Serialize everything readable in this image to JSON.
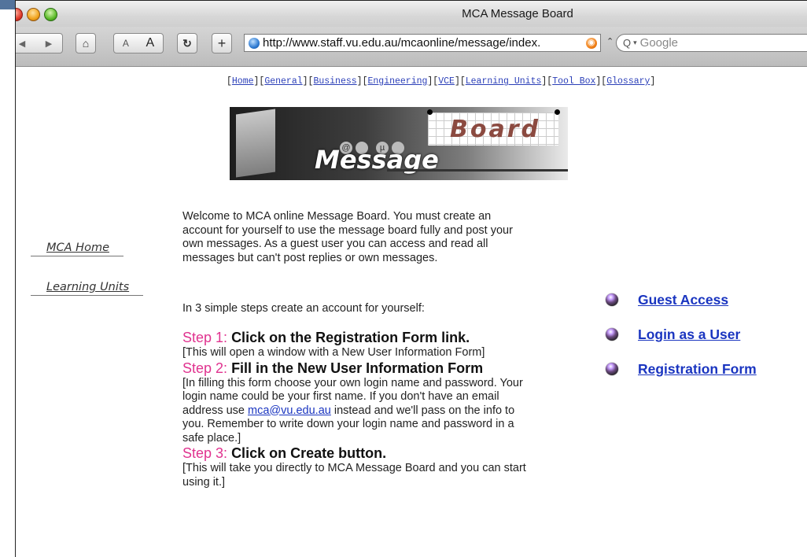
{
  "window": {
    "title": "MCA Message Board"
  },
  "toolbar": {
    "text_smaller": "A",
    "text_bigger": "A",
    "add_label": "+",
    "url": "http://www.staff.vu.edu.au/mcaonline/message/index.",
    "search_placeholder": "Google"
  },
  "topnav": {
    "items": [
      "Home",
      "General",
      "Business",
      "Engineering",
      "VCE",
      "Learning Units",
      "Tool Box",
      "Glossary"
    ]
  },
  "banner": {
    "word_board": "Board",
    "word_message": "Message",
    "symbols": [
      "@",
      "µ"
    ]
  },
  "sidebar": {
    "items": [
      "MCA Home",
      "Learning Units"
    ]
  },
  "main": {
    "welcome": "Welcome to MCA online Message Board. You must create an account for yourself to use the message board fully and post your own messages. As a  guest user you can access and read all  messages but can't post replies or own messages.",
    "steps_intro": "In 3 simple steps create an account for yourself:",
    "steps": [
      {
        "label": "Step 1:",
        "title": "Click on the Registration Form link.",
        "note": "[This will open a window with a New User Information Form]"
      },
      {
        "label": "Step 2:",
        "title": "Fill in the New User Information Form",
        "note_before": "[In filling this form choose your own login name and password. Your login name could be your first name. If you don't have an email address use ",
        "email": "mca@vu.edu.au",
        "note_after": " instead and we'll pass on the info to you. Remember to write down your login name and password in a safe place.]"
      },
      {
        "label": "Step 3:",
        "title": "Click on Create button.",
        "note": "[This will take you directly to MCA Message Board and you can start using it.]"
      }
    ]
  },
  "actions": {
    "items": [
      "Guest Access",
      "Login as a User",
      "Registration Form"
    ]
  },
  "colors": {
    "link": "#1a35c0",
    "step_label": "#e0338f",
    "topnav_link": "#2b3fb8"
  }
}
